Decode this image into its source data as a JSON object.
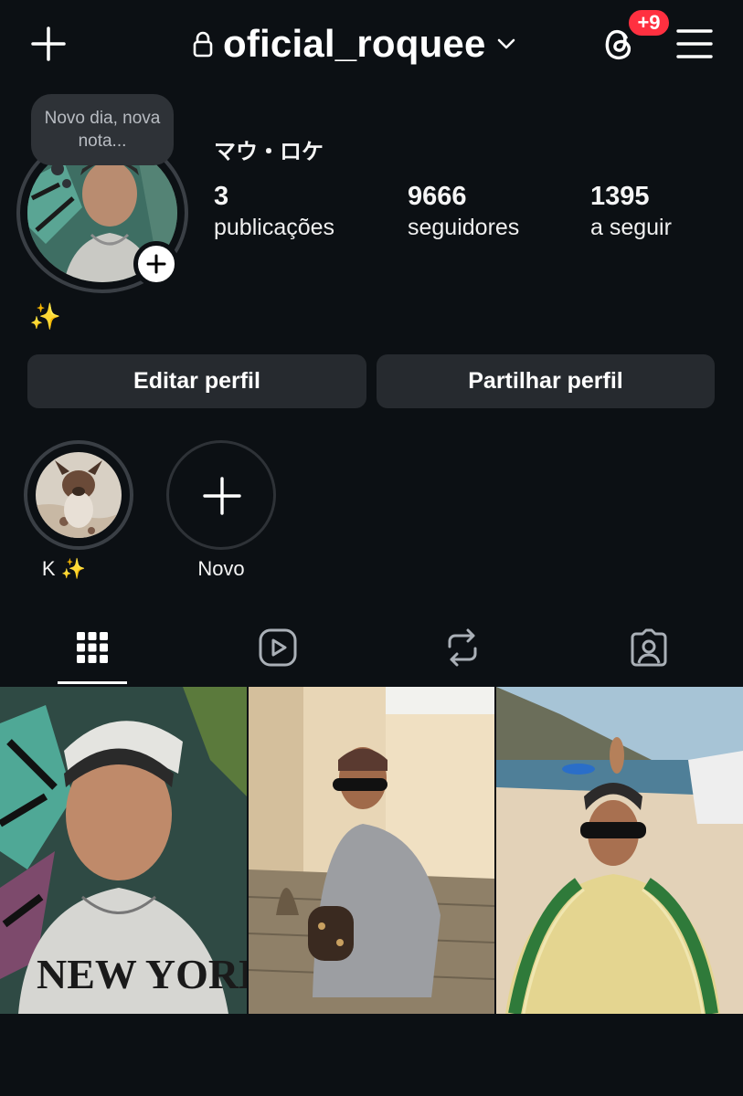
{
  "header": {
    "username": "oficial_roquee",
    "notification_badge": "+9",
    "icons": [
      "plus-icon",
      "lock-icon",
      "chevron-down-icon",
      "threads-icon",
      "menu-icon"
    ]
  },
  "profile": {
    "note": "Novo dia, nova nota...",
    "display_name": "マウ・ロケ",
    "stats": [
      {
        "value": "3",
        "label": "publicações"
      },
      {
        "value": "9666",
        "label": "seguidores"
      },
      {
        "value": "1395",
        "label": "a seguir"
      }
    ],
    "bio": "✨"
  },
  "actions": {
    "edit_label": "Editar perfil",
    "share_label": "Partilhar perfil"
  },
  "highlights": [
    {
      "label": "K ✨"
    },
    {
      "label": "Novo"
    }
  ],
  "tabs": [
    "grid-icon",
    "reels-icon",
    "reposts-icon",
    "tagged-icon"
  ],
  "colors": {
    "background": "#0c1014",
    "button": "#262a2f",
    "badge": "#ff3040",
    "note_bubble": "#2e3237"
  }
}
